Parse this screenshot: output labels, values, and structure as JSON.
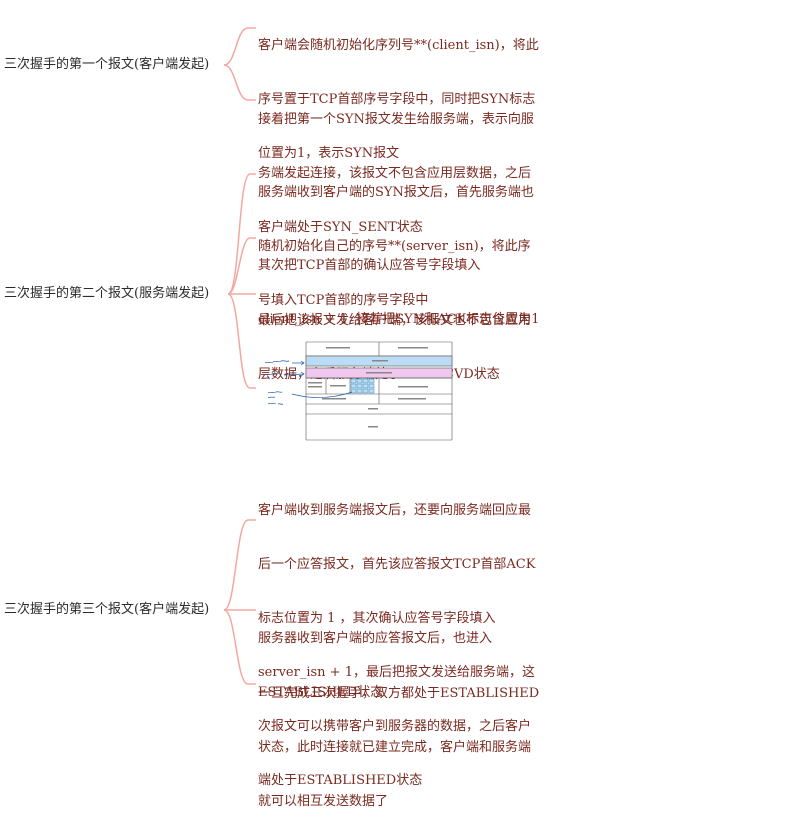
{
  "topics": [
    {
      "label": "三次握手的第一个报文(客户端发起)",
      "notes": [
        [
          "客户端会随机初始化序列号**(client_isn)，将此",
          "序号置于TCP首部序号字段中，同时把SYN标志",
          "位置为1，表示SYN报文"
        ],
        [
          "接着把第一个SYN报文发生给服务端，表示向服",
          "务端发起连接，该报文不包含应用层数据，之后",
          "客户端处于SYN_SENT状态"
        ]
      ]
    },
    {
      "label": "三次握手的第二个报文(服务端发起)",
      "notes": [
        [
          "服务端收到客户端的SYN报文后，首先服务端也",
          "随机初始化自己的序号**(server_isn)，将此序",
          "号填入TCP首部的序号字段中"
        ],
        [
          "其次把TCP首部的确认应答号字段填入",
          "client_isn + 1, 接着把SYN和ACK标志位置为1"
        ],
        [
          "最后把该报文发给客户端，该报文也不包含应用",
          "层数据，之后服务端处于SYN-RCVD状态"
        ]
      ]
    },
    {
      "label": "三次握手的第三个报文(客户端发起)",
      "notes": [
        [
          "客户端收到服务端报文后，还要向服务端回应最",
          "后一个应答报文，首先该应答报文TCP首部ACK",
          "标志位置为 1 ，其次确认应答号字段填入",
          "server_isn + 1，最后把报文发送给服务端，这",
          "次报文可以携带客户到服务器的数据，之后客户",
          "端处于ESTABLISHED状态"
        ],
        [
          "服务器收到客户端的应答报文后，也进入",
          "ESTABLISHED状态"
        ],
        [
          "一旦完成三次握手，双方都处于ESTABLISHED",
          "状态，此时连接就已建立完成，客户端和服务端",
          "就可以相互发送数据了"
        ]
      ]
    }
  ],
  "colors": {
    "branch": "#f2a8a0",
    "note_text": "#7a2a20",
    "topic_text": "#2b2b2b",
    "seq_highlight": "#bcdcf5",
    "ack_highlight": "#f0c8ee"
  }
}
